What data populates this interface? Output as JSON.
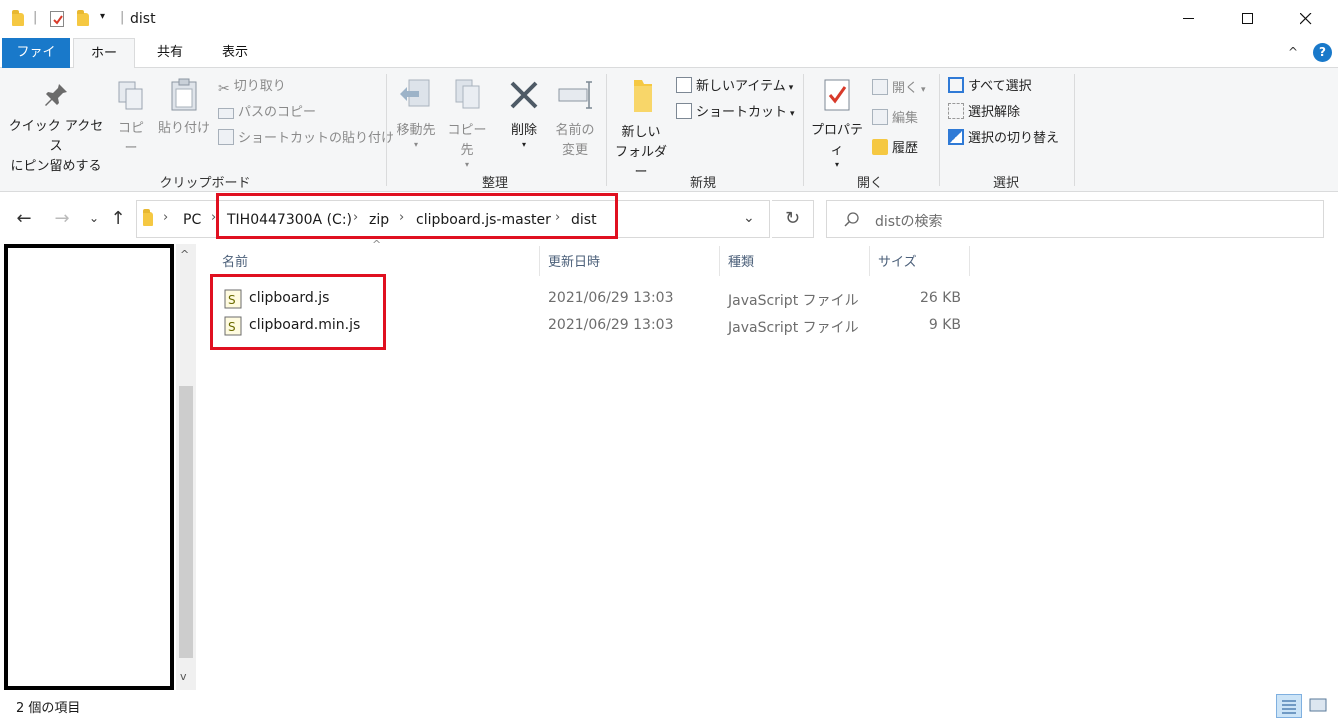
{
  "window": {
    "title": "dist"
  },
  "tabs": [
    "ファイル",
    "ホーム",
    "共有",
    "表示"
  ],
  "ribbon": {
    "clipboard": {
      "pin_line1": "クイック アクセス",
      "pin_line2": "にピン留めする",
      "copy": "コピー",
      "paste": "貼り付け",
      "cut": "切り取り",
      "copy_path": "パスのコピー",
      "paste_shortcut": "ショートカットの貼り付け",
      "label": "クリップボード"
    },
    "organize": {
      "move_to": "移動先",
      "copy_to": "コピー先",
      "delete": "削除",
      "rename_line1": "名前の",
      "rename_line2": "変更",
      "label": "整理"
    },
    "new": {
      "new_folder_line1": "新しい",
      "new_folder_line2": "フォルダー",
      "new_item": "新しいアイテム",
      "shortcut": "ショートカット",
      "label": "新規"
    },
    "open": {
      "properties": "プロパティ",
      "open": "開く",
      "edit": "編集",
      "history": "履歴",
      "label": "開く"
    },
    "select": {
      "select_all": "すべて選択",
      "select_none": "選択解除",
      "invert": "選択の切り替え",
      "label": "選択"
    }
  },
  "address": {
    "crumbs": [
      "PC",
      "TIH0447300A (C:)",
      "zip",
      "clipboard.js-master",
      "dist"
    ]
  },
  "search": {
    "placeholder": "distの検索"
  },
  "columns": {
    "name": "名前",
    "date": "更新日時",
    "type": "種類",
    "size": "サイズ"
  },
  "files": [
    {
      "name": "clipboard.js",
      "date": "2021/06/29 13:03",
      "type": "JavaScript ファイル",
      "size": "26 KB"
    },
    {
      "name": "clipboard.min.js",
      "date": "2021/06/29 13:03",
      "type": "JavaScript ファイル",
      "size": "9 KB"
    }
  ],
  "status": {
    "count": "2 個の項目"
  },
  "colors": {
    "file_tab": "#1979ca",
    "highlight": "#e01020",
    "ribbon_bg": "#f5f6f7"
  }
}
